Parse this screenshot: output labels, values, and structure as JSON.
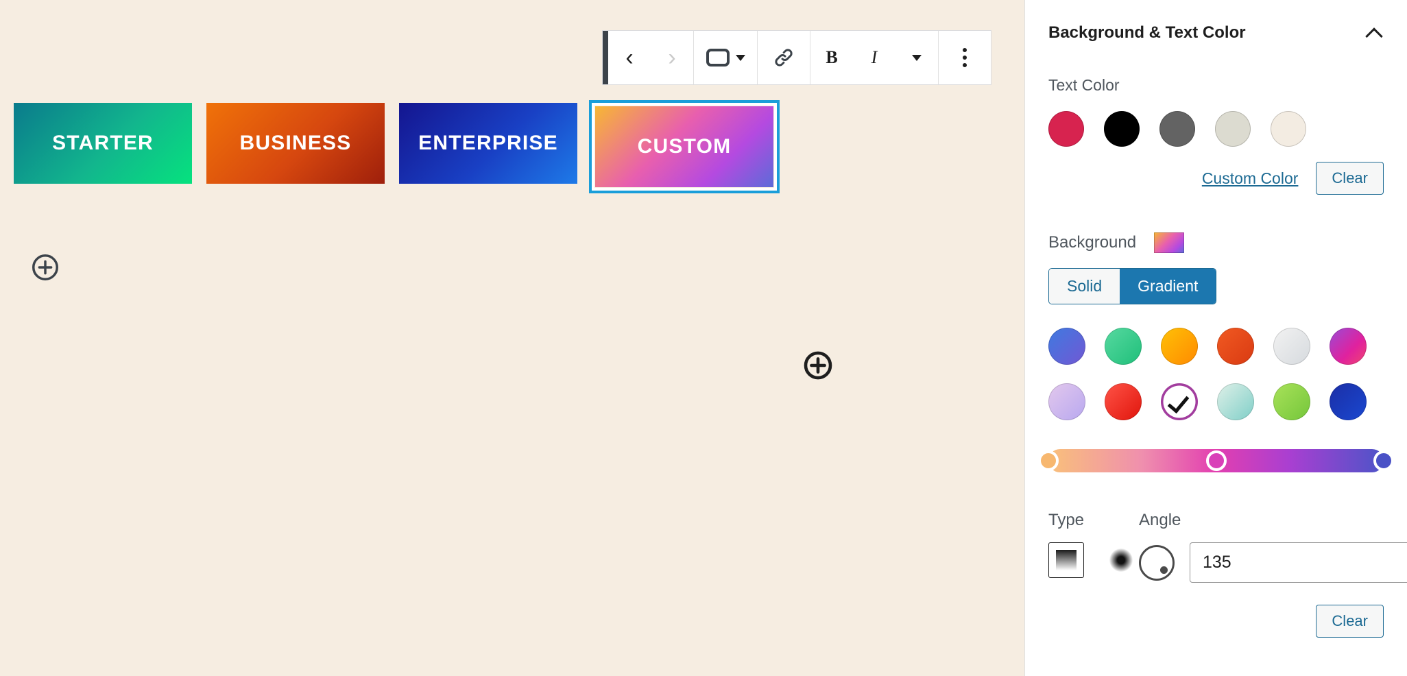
{
  "canvas": {
    "background_color": "#f6ede1",
    "toolbar": {
      "items": [
        {
          "name": "move-up",
          "label": "‹",
          "icon": "chevron-left-icon",
          "disabled": false
        },
        {
          "name": "move-down",
          "label": "›",
          "icon": "chevron-right-icon",
          "disabled": true
        },
        {
          "name": "block-type",
          "label": "",
          "icon": "button-block-icon",
          "has_caret": true
        },
        {
          "name": "link",
          "label": "",
          "icon": "link-icon"
        },
        {
          "name": "bold",
          "label": "B",
          "icon": "bold-icon"
        },
        {
          "name": "italic",
          "label": "I",
          "icon": "italic-icon"
        },
        {
          "name": "more-rich-text",
          "label": "",
          "icon": "caret-down-icon"
        },
        {
          "name": "options",
          "label": "",
          "icon": "kebab-menu-icon"
        }
      ]
    },
    "buttons": [
      {
        "label": "STARTER",
        "gradient": "linear-gradient(135deg, #0a7b8c 0%, #12b68d 55%, #06e27e 100%)",
        "selected": false
      },
      {
        "label": "BUSINESS",
        "gradient": "linear-gradient(135deg, #f07209 0%, #d6470f 55%, #9e1f0b 100%)",
        "selected": false
      },
      {
        "label": "ENTERPRISE",
        "gradient": "linear-gradient(135deg, #14158f 0%, #1940c4 55%, #1e7ae8 100%)",
        "selected": false
      },
      {
        "label": "CUSTOM",
        "gradient": "linear-gradient(135deg, #f7b733 0%, #e85fae 42%, #b44ae0 72%, #5c6bd8 100%)",
        "selected": true,
        "selection_color": "#1a9ed9"
      }
    ],
    "add_block_buttons": [
      {
        "name": "appender-inline",
        "icon": "plus-circle-icon",
        "tone": "muted"
      },
      {
        "name": "appender-canvas",
        "icon": "plus-circle-icon",
        "tone": "strong"
      }
    ]
  },
  "sidebar": {
    "panel_title": "Background & Text Color",
    "collapse_icon": "chevron-up-icon",
    "text_color": {
      "label": "Text Color",
      "swatches": [
        {
          "name": "crimson",
          "color": "#d7234f"
        },
        {
          "name": "black",
          "color": "#000000"
        },
        {
          "name": "dark-gray",
          "color": "#636363"
        },
        {
          "name": "light-gray",
          "color": "#dcdbd0"
        },
        {
          "name": "off-white",
          "color": "#f3ece2"
        }
      ],
      "custom_color_link": "Custom Color",
      "clear_label": "Clear"
    },
    "background": {
      "label": "Background",
      "preview_gradient": "linear-gradient(135deg, #f7b733 0%, #e85fae 45%, #b44ae0 75%, #5c6bd8 100%)",
      "tabs": [
        {
          "label": "Solid",
          "active": false
        },
        {
          "label": "Gradient",
          "active": true
        }
      ],
      "gradient_swatches": [
        [
          {
            "name": "blue-violet",
            "gradient": "linear-gradient(135deg, #3f7ae0 0%, #7158d4 100%)",
            "selected": false
          },
          {
            "name": "green-mint",
            "gradient": "linear-gradient(135deg, #57d9a0 0%, #1fbf7a 100%)",
            "selected": false
          },
          {
            "name": "amber-orange",
            "gradient": "linear-gradient(135deg, #ffc107 0%, #ff8a00 100%)",
            "selected": false
          },
          {
            "name": "red-orange",
            "gradient": "linear-gradient(135deg, #f15a22 0%, #d93a12 100%)",
            "selected": false
          },
          {
            "name": "pale-silver",
            "gradient": "linear-gradient(135deg, #f2f2f2 0%, #d6dade 100%)",
            "selected": false
          },
          {
            "name": "purple-pink",
            "gradient": "linear-gradient(135deg, #9a4bd6 0%, #e0219e 60%, #f0466f 100%)",
            "selected": false
          }
        ],
        [
          {
            "name": "lavender",
            "gradient": "linear-gradient(135deg, #e3c8ec 0%, #b8a8f0 100%)",
            "selected": false
          },
          {
            "name": "red-scarlet",
            "gradient": "linear-gradient(135deg, #ff5347 0%, #e0150c 100%)",
            "selected": false
          },
          {
            "name": "custom-current",
            "gradient": "linear-gradient(135deg, #f7b733 0%, #e85fae 45%, #b44ae0 100%)",
            "selected": true
          },
          {
            "name": "aqua-pale",
            "gradient": "linear-gradient(135deg, #dff0e8 0%, #7fcfc8 100%)",
            "selected": false
          },
          {
            "name": "lime-green",
            "gradient": "linear-gradient(135deg, #a9e25a 0%, #74c63a 100%)",
            "selected": false
          },
          {
            "name": "deep-blue",
            "gradient": "linear-gradient(135deg, #1b2ea6 0%, #1a48d0 100%)",
            "selected": false
          }
        ]
      ],
      "gradient_bar": {
        "css": "linear-gradient(90deg, #f9c07a 0%, #ef8fae 28%, #e23fb0 50%, #a93fd1 72%, #4d54c8 100%)",
        "stops": [
          {
            "name": "stop-1",
            "position": 0,
            "color": "#f7b76f"
          },
          {
            "name": "stop-2",
            "position": 50,
            "color": "#d940b8"
          },
          {
            "name": "stop-3",
            "position": 100,
            "color": "#4a51c6"
          }
        ]
      },
      "type": {
        "label": "Type",
        "options": [
          {
            "name": "linear-gradient",
            "selected": true
          },
          {
            "name": "radial-gradient",
            "selected": false
          }
        ]
      },
      "angle": {
        "label": "Angle",
        "value": "135"
      },
      "clear_label": "Clear"
    }
  }
}
